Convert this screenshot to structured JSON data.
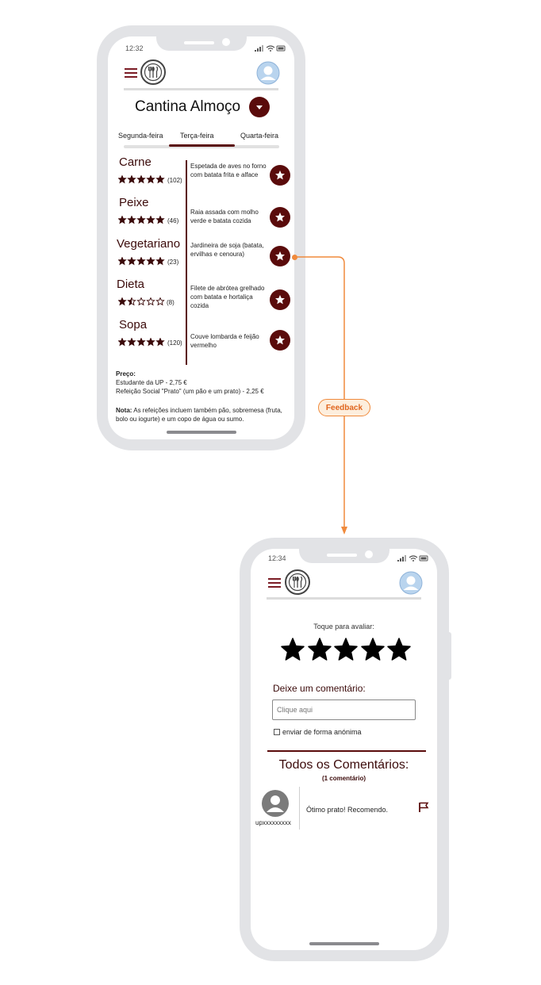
{
  "connector": {
    "label": "Feedback"
  },
  "menu_screen": {
    "status_time": "12:32",
    "title": "Cantina Almoço",
    "tabs": [
      {
        "label": "Segunda-feira",
        "selected": false
      },
      {
        "label": "Terça-feira",
        "selected": true
      },
      {
        "label": "Quarta-feira",
        "selected": false
      }
    ],
    "items": [
      {
        "category": "Carne",
        "rating": 5,
        "count": "(102)",
        "dish": "Espetada de aves no forno com batata frita e alface"
      },
      {
        "category": "Peixe",
        "rating": 5,
        "count": "(46)",
        "dish": "Raia assada com molho verde e batata cozida"
      },
      {
        "category": "Vegetariano",
        "rating": 5,
        "count": "(23)",
        "dish": "Jardineira de soja (batata, ervilhas e cenoura)"
      },
      {
        "category": "Dieta",
        "rating": 1.5,
        "count": "(8)",
        "dish": "Filete de abrótea grelhado com batata e hortaliça cozida"
      },
      {
        "category": "Sopa",
        "rating": 5,
        "count": "(120)",
        "dish": "Couve lombarda e feijão vermelho"
      }
    ],
    "price_heading": "Preço:",
    "price_lines": [
      "Estudante da UP - 2,75 €",
      "Refeição Social \"Prato\" (um pão e um prato) - 2,25 €"
    ],
    "note_label": "Nota:",
    "note_text": "As refeições incluem também pão, sobremesa (fruta, bolo ou iogurte) e um copo de água ou sumo.",
    "colors": {
      "accent": "#5a0b0b",
      "menu_icon": "#7b1c25"
    }
  },
  "feedback_screen": {
    "status_time": "12:34",
    "rate_prompt": "Toque para avaliar:",
    "star_count": 5,
    "comment_label": "Deixe um comentário:",
    "comment_placeholder": "Clique aqui",
    "anonymous_label": "enviar de forma anónima",
    "all_comments_title": "Todos os Comentários:",
    "comment_count": "(1 comentário)",
    "comments": [
      {
        "user": "upxxxxxxxxx",
        "text": "Ótimo prato! Recomendo."
      }
    ]
  },
  "icons": [
    "menu-icon",
    "restaurant-logo-icon",
    "avatar-icon",
    "dropdown-icon",
    "star-icon",
    "favorite-star-icon",
    "flag-icon",
    "wifi-icon",
    "signal-icon",
    "battery-icon"
  ]
}
